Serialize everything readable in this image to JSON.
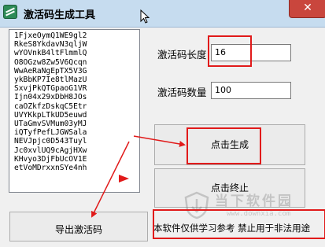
{
  "window": {
    "title": "激活码生成工具",
    "close_label": "✕"
  },
  "codes": [
    "1FjxeOymQ1WE9gl2",
    "RkeS8YkdavN3qljW",
    "wYOVnkB4ltFlmmlQ",
    "O8OGzw8Zw5V6Qcqn",
    "WwAeRaNgEpTX5V3G",
    "ykBbKP7Ie8tlMazU",
    "SxvjPkQTGpaoG1VR",
    "Ijn04x29xDbH8JOs",
    "caOZkfzDskqC5Etr",
    "UVYKkpLTkUD5euwd",
    "UTaGmvSVMum03yMJ",
    "iQTyfPefLJGWSala",
    "NEVJpjc0D543Tuyl",
    "Jc0xvlUQ9cAgjHXw",
    "KHvyo3DjFbUcOV1E",
    "etVoMDrxxnSYe4nh"
  ],
  "settings": {
    "length_label": "激活码长度",
    "length_value": "16",
    "count_label": "激活码数量",
    "count_value": "100"
  },
  "buttons": {
    "generate": "点击生成",
    "stop": "点击终止",
    "export": "导出激活码"
  },
  "footer_note": "本软件仅供学习参考  禁止用于非法用途",
  "watermark": {
    "text": "当下软件园",
    "url": "www.downxia.com"
  },
  "colors": {
    "annotation": "#e11a1a",
    "titlebar": "#c6dcef",
    "close": "#c9463d"
  }
}
